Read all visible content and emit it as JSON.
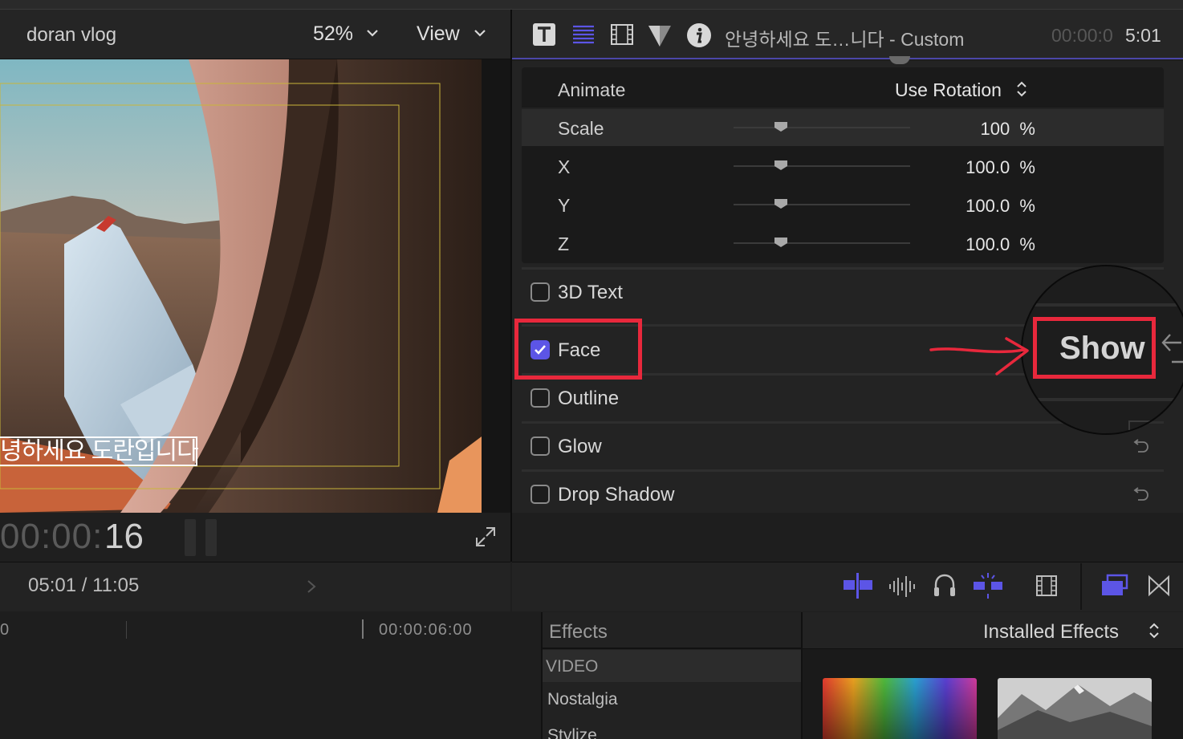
{
  "viewer": {
    "title": "doran vlog",
    "zoom": "52%",
    "view_menu": "View",
    "subtitle": "녕하세요 도란입니다",
    "timecode_prefix": "00:00:",
    "timecode_frames": "16",
    "icons": [
      "chevron-down-icon",
      "fullscreen-icon",
      "pause-icon"
    ]
  },
  "inspector": {
    "tabs": [
      "text-tab-icon",
      "paragraph-tab-icon",
      "video-tab-icon",
      "filter-tab-icon",
      "info-icon"
    ],
    "title": "안녕하세요 도…니다 - Custom",
    "timecode_dim": "00:00:0",
    "timecode_bright": "5:01",
    "accent": "#5c55e6",
    "animate": {
      "label": "Animate",
      "value": "Use Rotation"
    },
    "params": [
      {
        "label": "Scale",
        "value": "100  %",
        "slider": 0.27
      },
      {
        "label": "X",
        "value": "100.0  %",
        "slider": 0.27
      },
      {
        "label": "Y",
        "value": "100.0  %",
        "slider": 0.27
      },
      {
        "label": "Z",
        "value": "100.0  %",
        "slider": 0.27
      }
    ],
    "sections": [
      {
        "label": "3D Text",
        "checked": false
      },
      {
        "label": "Face",
        "checked": true
      },
      {
        "label": "Outline",
        "checked": false
      },
      {
        "label": "Glow",
        "checked": false
      },
      {
        "label": "Drop Shadow",
        "checked": false
      }
    ],
    "magnified_label": "Show",
    "highlight_color": "#e8283c"
  },
  "toolbar": {
    "playhead": "05:01 / 11:05",
    "icons": [
      "clip-connect-icon",
      "audio-waveform-icon",
      "headphones-icon",
      "snapping-icon",
      "clip-appearance-icon",
      "browser-toggle-icon",
      "transitions-icon"
    ]
  },
  "timeline": {
    "ruler_start": "0",
    "ruler_mark": "00:00:06:00"
  },
  "effects": {
    "title": "Effects",
    "category": "VIDEO",
    "items": [
      "Nostalgia",
      "Stylize"
    ],
    "selector": "Installed Effects"
  }
}
